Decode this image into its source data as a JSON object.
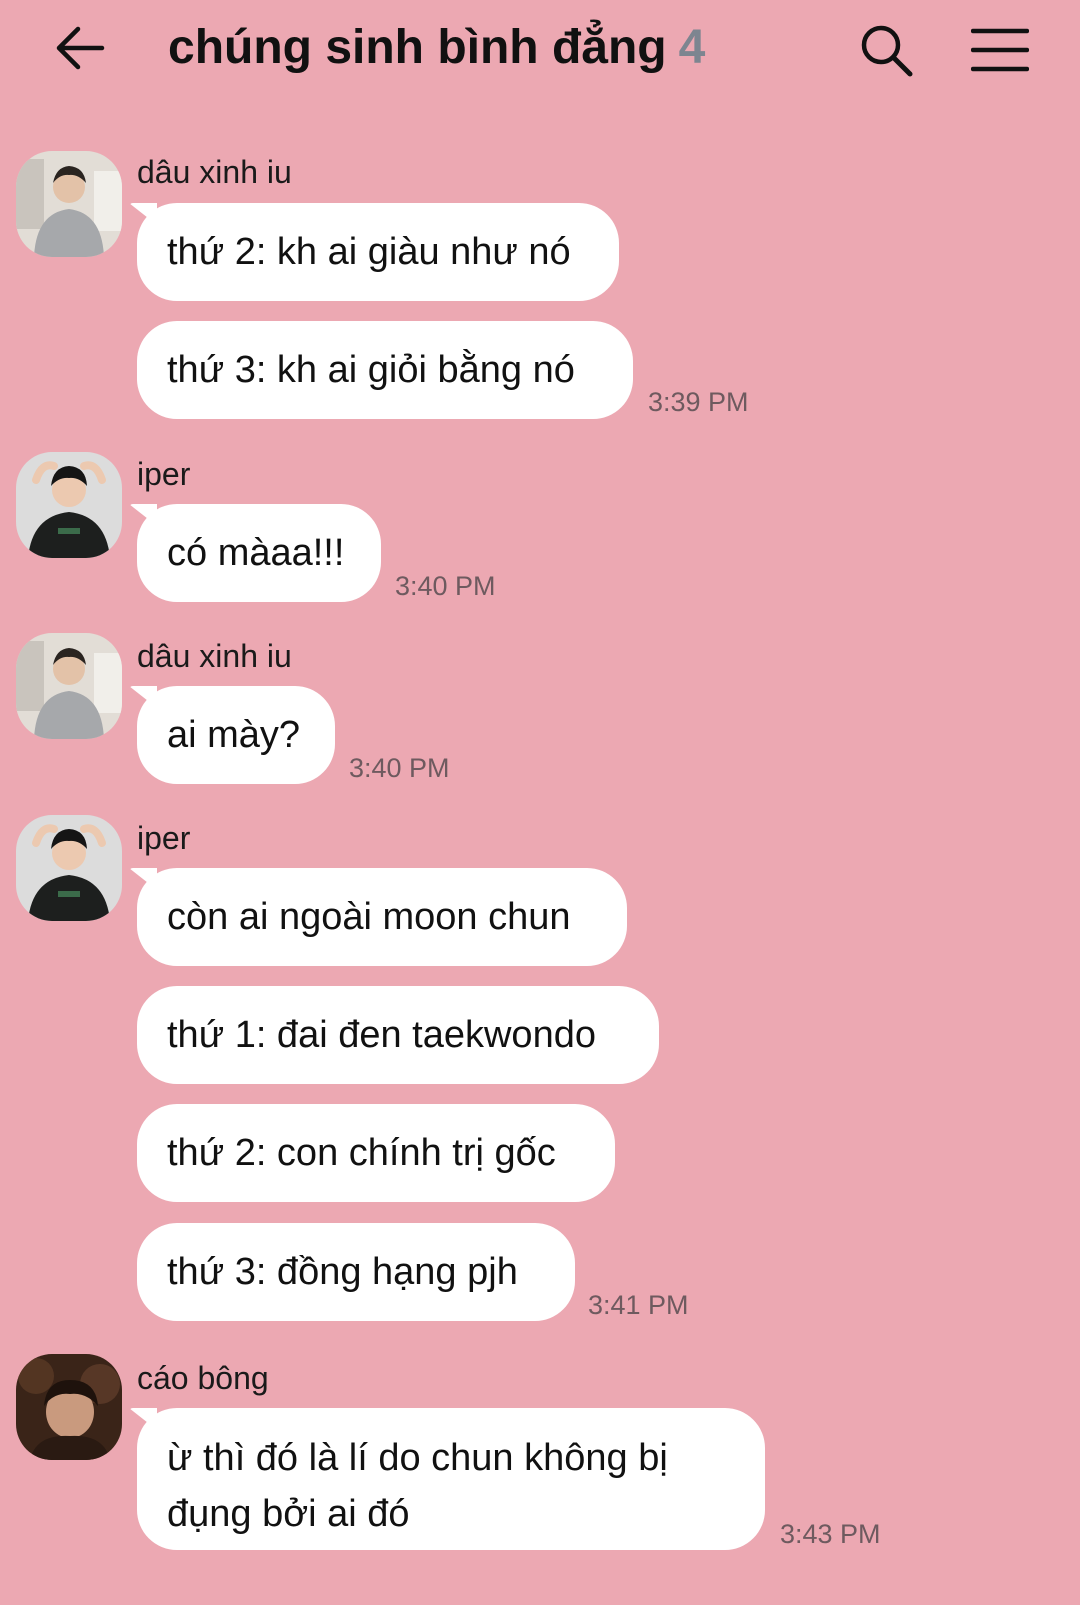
{
  "header": {
    "title": "chúng sinh bình đẳng",
    "member_count": "4"
  },
  "messages": [
    {
      "sender": "dâu xinh iu",
      "texts": [
        "thứ 2: kh ai giàu như nó",
        "thứ 3: kh ai giỏi bằng nó"
      ],
      "time": "3:39 PM"
    },
    {
      "sender": "iper",
      "texts": [
        "có màaa!!!"
      ],
      "time": "3:40 PM"
    },
    {
      "sender": "dâu xinh iu",
      "texts": [
        "ai mày?"
      ],
      "time": "3:40 PM"
    },
    {
      "sender": "iper",
      "texts": [
        "còn ai ngoài moon chun",
        "thứ 1: đai đen taekwondo",
        "thứ 2: con chính trị gốc",
        "thứ 3: đồng hạng pjh"
      ],
      "time": "3:41 PM"
    },
    {
      "sender": "cáo bông",
      "texts": [
        "ừ thì đó là lí do chun không bị đụng bởi ai đó"
      ],
      "time": "3:43 PM"
    }
  ],
  "colors": {
    "background": "#eca8b2",
    "bubble": "#ffffff",
    "count": "#7d8590"
  },
  "icons": [
    "back-arrow-icon",
    "search-icon",
    "menu-icon"
  ]
}
